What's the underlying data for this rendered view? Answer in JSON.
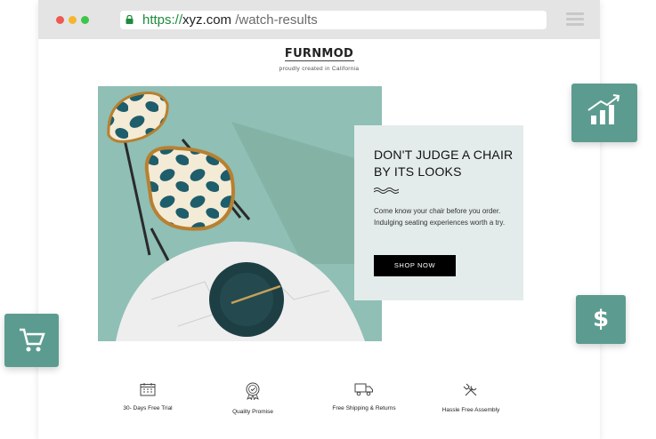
{
  "browser": {
    "url_scheme": "https://",
    "url_domain": "xyz.com",
    "url_path": "/watch-results",
    "dot_colors": [
      "#ee5a52",
      "#f5b62e",
      "#3ec549"
    ]
  },
  "site": {
    "brand": "FURNMOD",
    "tagline": "proudly created in California"
  },
  "promo": {
    "title": "DON'T JUDGE A CHAIR BY ITS LOOKS",
    "body": "Come know your chair before you order. Indulging seating experiences worth a try.",
    "cta_label": "SHOP NOW"
  },
  "features": [
    {
      "label": "30- Days Free Trial",
      "icon": "calendar-icon"
    },
    {
      "label": "Quality Promise",
      "icon": "quality-badge-icon"
    },
    {
      "label": "Free Shipping & Returns",
      "icon": "truck-icon"
    },
    {
      "label": "Hassle Free Assembly",
      "icon": "tools-icon"
    }
  ],
  "floating_cards": {
    "icons": [
      "growth-chart-icon",
      "dollar-icon",
      "cart-icon"
    ],
    "dollar_symbol": "$",
    "color": "#5c9c90"
  },
  "colors": {
    "accent": "#5c9c90",
    "hero_background": "#8fbfb5",
    "url_green": "#1e8a3c"
  }
}
